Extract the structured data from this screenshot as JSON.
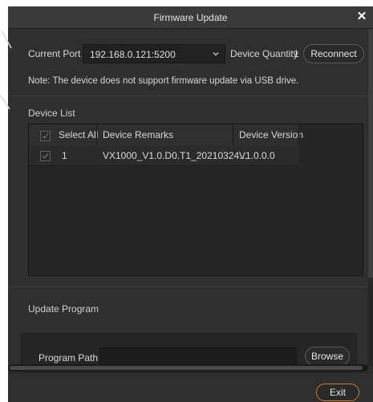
{
  "window": {
    "title": "Firmware Update",
    "close_icon": "close-icon"
  },
  "port": {
    "label": "Current Port",
    "selected": "192.168.0.121:5200",
    "device_quantity_label": "Device Quantity",
    "device_quantity_value": "1",
    "reconnect_label": "Reconnect"
  },
  "note": "Note: The device does not support firmware update via USB drive.",
  "device_list": {
    "title": "Device List",
    "columns": [
      "Select All",
      "Device Remarks",
      "Device Version"
    ],
    "rows": [
      {
        "index": "1",
        "remarks": "VX1000_V1.0.D0.T1_20210324...",
        "version": "V1.0.0.0"
      }
    ]
  },
  "update_program": {
    "title": "Update Program",
    "path_label": "Program Path",
    "path_value": "",
    "browse_label": "Browse"
  },
  "footer": {
    "exit_label": "Exit"
  },
  "colors": {
    "background": "#2f2f2f",
    "accent": "#d07a2a",
    "text": "#d8d8d8"
  }
}
